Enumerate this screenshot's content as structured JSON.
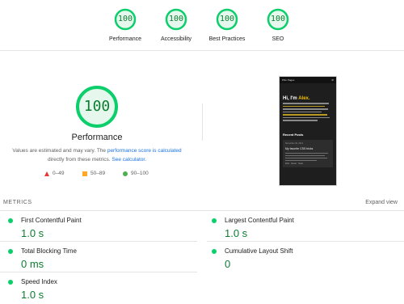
{
  "categories": [
    {
      "score": "100",
      "label": "Performance",
      "color": "#0cce6b"
    },
    {
      "score": "100",
      "label": "Accessibility",
      "color": "#0cce6b"
    },
    {
      "score": "100",
      "label": "Best Practices",
      "color": "#0cce6b"
    },
    {
      "score": "100",
      "label": "SEO",
      "color": "#0cce6b"
    }
  ],
  "hero": {
    "score": "100",
    "title": "Performance",
    "note_prefix": "Values are estimated and may vary. The ",
    "note_link1": "performance score is calculated",
    "note_mid": " directly from these metrics. ",
    "note_link2": "See calculator."
  },
  "legend": [
    {
      "icon": "fail-triangle-icon",
      "range": "0–49",
      "color": "#e53935"
    },
    {
      "icon": "average-square-icon",
      "range": "50–89",
      "color": "#ffa726"
    },
    {
      "icon": "pass-circle-icon",
      "range": "90–100",
      "color": "#4caf50"
    }
  ],
  "metrics_section": {
    "heading": "METRICS",
    "expand_label": "Expand view",
    "items": [
      {
        "label": "First Contentful Paint",
        "value": "1.0 s",
        "status": "pass"
      },
      {
        "label": "Largest Contentful Paint",
        "value": "1.0 s",
        "status": "pass"
      },
      {
        "label": "Total Blocking Time",
        "value": "0 ms",
        "status": "pass"
      },
      {
        "label": "Cumulative Layout Shift",
        "value": "0",
        "status": "pass"
      },
      {
        "label": "Speed Index",
        "value": "1.0 s",
        "status": "pass"
      }
    ]
  },
  "preview": {
    "site_name": "Phin Pages",
    "greeting": "Hi, I'm ",
    "greeting_name": "Alex.",
    "recent_heading": "Recent Posts",
    "post_date": "November 20, 2021",
    "post_title": "My favorite CSS tricks",
    "post_tags": "Web · React · Node"
  }
}
